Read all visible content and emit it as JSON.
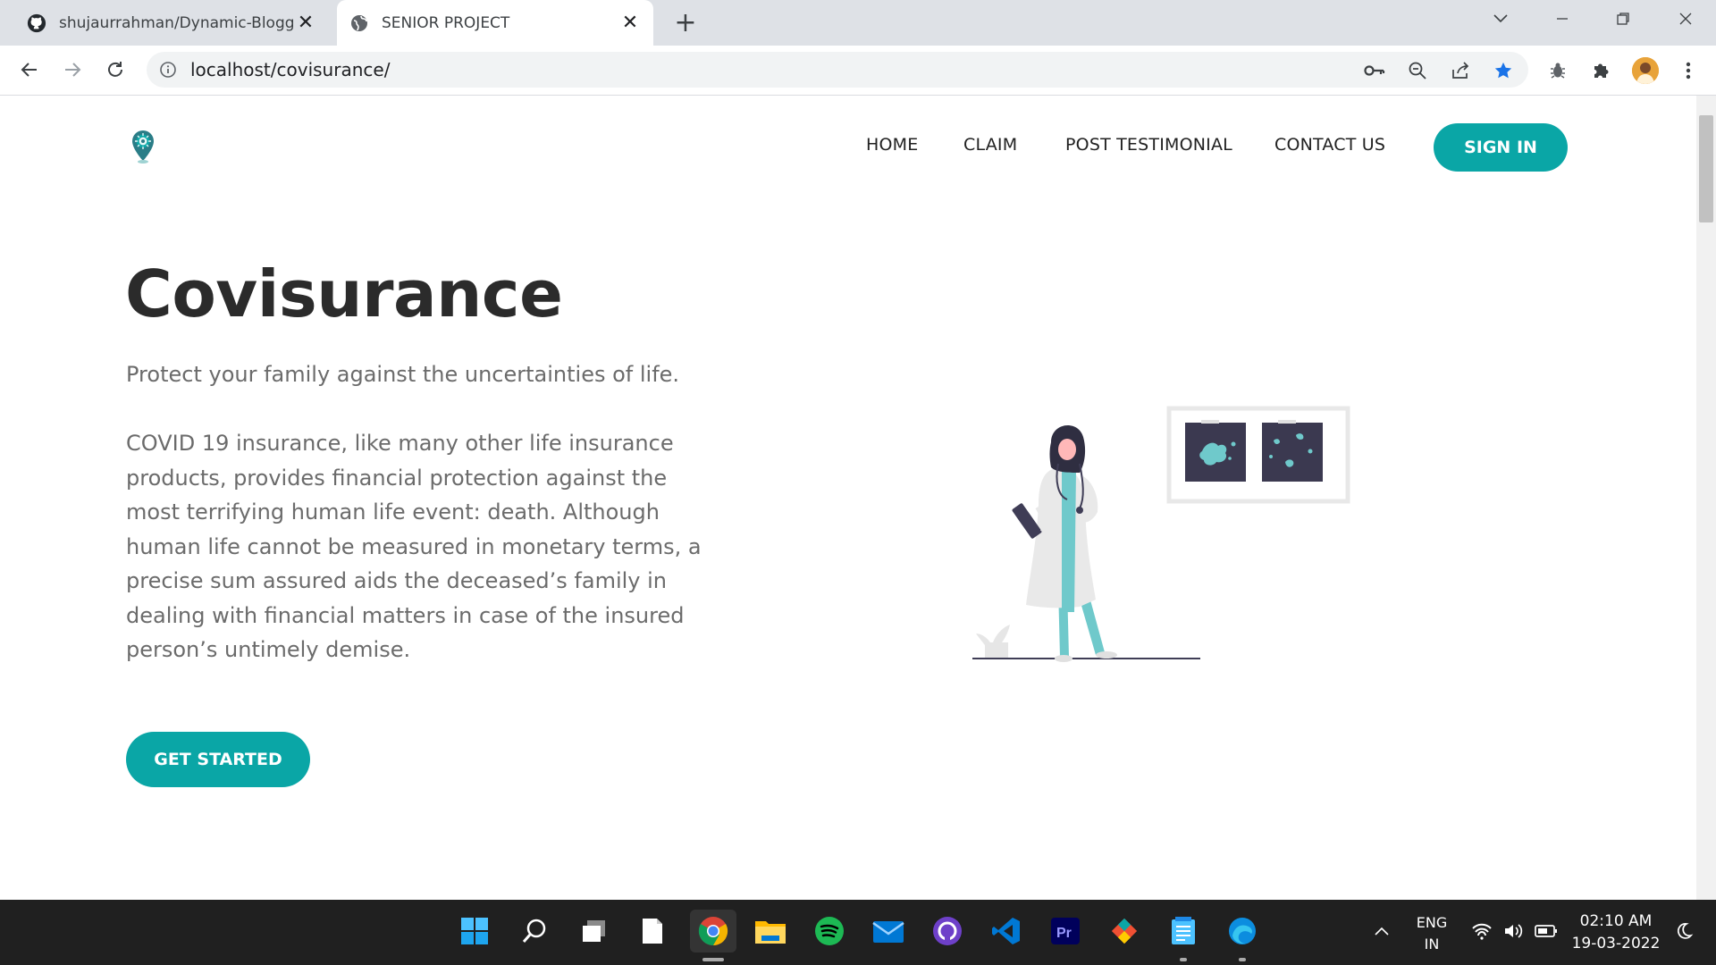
{
  "browser": {
    "tabs": [
      {
        "title": "shujaurrahman/Dynamic-Blogger",
        "active": false,
        "icon": "github-icon"
      },
      {
        "title": "SENIOR PROJECT",
        "active": true,
        "icon": "globe-icon"
      }
    ],
    "url": "localhost/covisurance/"
  },
  "nav": {
    "items": [
      "HOME",
      "CLAIM",
      "POST TESTIMONIAL",
      "CONTACT US"
    ],
    "signin_label": "SIGN IN"
  },
  "hero": {
    "title": "Covisurance",
    "tagline": "Protect your family against the uncertainties of life.",
    "description": "COVID 19 insurance, like many other life insurance products, provides financial protection against the most terrifying human life event: death. Although human life cannot be measured in monetary terms, a precise sum assured aids the deceased’s family in dealing with financial matters in case of the insured person’s untimely demise.",
    "cta_label": "GET STARTED"
  },
  "colors": {
    "accent": "#0aa6a6",
    "heading": "#2b2b2b",
    "body_text": "#6b6b6b"
  },
  "taskbar": {
    "apps": [
      "start-icon",
      "search-icon",
      "task-view-icon",
      "notepad-icon",
      "chrome-icon",
      "file-explorer-icon",
      "spotify-icon",
      "mail-icon",
      "github-desktop-icon",
      "vscode-icon",
      "premiere-pro-icon",
      "git-icon",
      "notepad-app-icon",
      "edge-icon"
    ],
    "language": "ENG",
    "region": "IN",
    "time": "02:10 AM",
    "date": "19-03-2022"
  }
}
